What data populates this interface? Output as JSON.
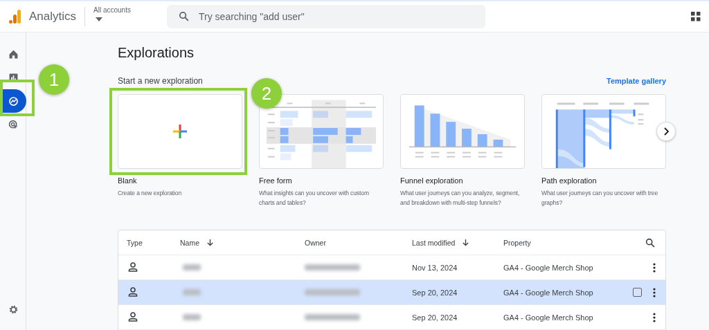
{
  "header": {
    "product": "Analytics",
    "account_label": "All accounts",
    "search": {
      "placeholder": "Try searching \"add user\""
    }
  },
  "sidebar": {
    "items": [
      {
        "kind": "home",
        "selected": false
      },
      {
        "kind": "reports",
        "selected": false
      },
      {
        "kind": "explore",
        "selected": true
      },
      {
        "kind": "advertising",
        "selected": false
      }
    ],
    "footer": {
      "kind": "settings"
    }
  },
  "page": {
    "title": "Explorations",
    "subtitle": "Start a new exploration",
    "gallery_link": "Template gallery",
    "templates": [
      {
        "kind": "blank",
        "title": "Blank",
        "description": "Create a new exploration"
      },
      {
        "kind": "freeform",
        "title": "Free form",
        "description": "What insights can you uncover with custom charts and tables?"
      },
      {
        "kind": "funnel",
        "title": "Funnel exploration",
        "description": "What user journeys can you analyze, segment, and breakdown with multi-step funnels?"
      },
      {
        "kind": "path",
        "title": "Path exploration",
        "description": "What user journeys can you uncover with tree graphs?"
      }
    ]
  },
  "table": {
    "columns": [
      {
        "label": "Type",
        "sorted": false
      },
      {
        "label": "Name",
        "sorted": true
      },
      {
        "label": "Owner",
        "sorted": false
      },
      {
        "label": "Last modified",
        "sorted": true
      },
      {
        "label": "Property",
        "sorted": false
      }
    ],
    "rows": [
      {
        "last_modified": "Nov 13, 2024",
        "property": "GA4 - Google Merch Shop",
        "selected": false
      },
      {
        "last_modified": "Sep 20, 2024",
        "property": "GA4 - Google Merch Shop",
        "selected": true
      },
      {
        "last_modified": "Sep 20, 2024",
        "property": "GA4 - Google Merch Shop",
        "selected": false
      }
    ]
  },
  "annotations": [
    {
      "label": "1"
    },
    {
      "label": "2"
    }
  ]
}
